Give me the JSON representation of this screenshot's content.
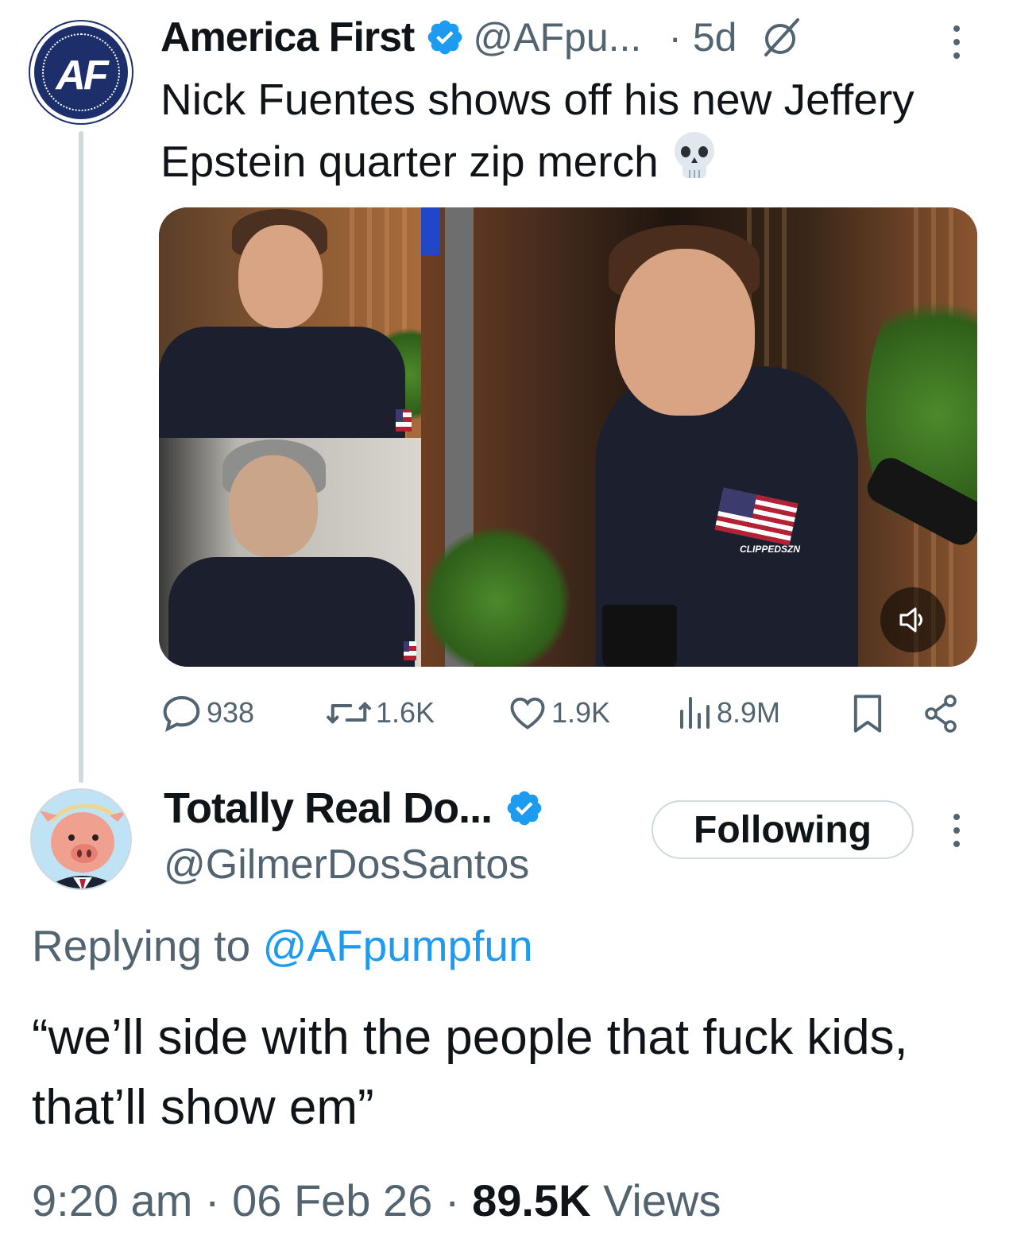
{
  "original_tweet": {
    "author_name": "America First",
    "avatar_text": "AF",
    "handle": "@AFpu...",
    "time_ago": "· 5d",
    "text": "Nick Fuentes shows off his new Jeffery Epstein quarter zip merch",
    "emoji": "skull",
    "media": {
      "watermark": "CLIPPEDSZN"
    },
    "actions": {
      "replies": "938",
      "reposts": "1.6K",
      "likes": "1.9K",
      "views": "8.9M"
    }
  },
  "reply_tweet": {
    "author_name": "Totally Real Do...",
    "handle": "@GilmerDosSantos",
    "follow_label": "Following",
    "replying_prefix": "Replying to",
    "replying_to": "@AFpumpfun",
    "text": "“we’ll side with the people that fuck kids, that’ll show em”",
    "timestamp": "9:20 am · 06 Feb 26 ·",
    "views_count": "89.5K",
    "views_label": "Views"
  },
  "colors": {
    "accent": "#1d9bf0",
    "secondary_text": "#536471",
    "primary_text": "#0f1419",
    "divider": "#cfd9de"
  }
}
